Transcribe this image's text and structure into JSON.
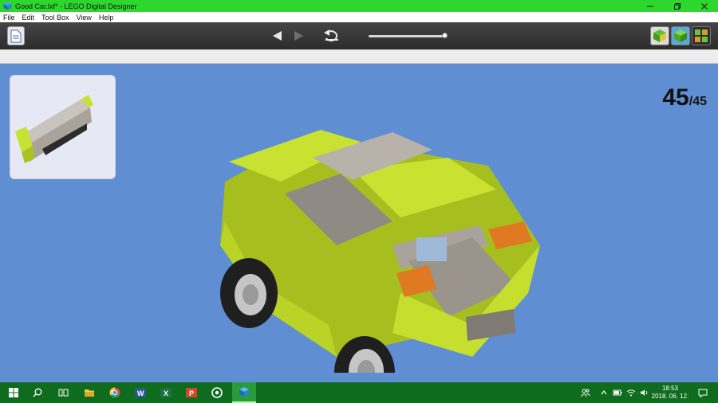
{
  "window": {
    "title": "Good Car.lxf* - LEGO Digital Designer",
    "titlebar_color": "#2ed72e"
  },
  "menu": {
    "items": [
      "File",
      "Edit",
      "Tool Box",
      "View",
      "Help"
    ]
  },
  "toolbar": {
    "slider_position": 1.0
  },
  "viewport": {
    "background_color": "#5f8fd2",
    "step_current": "45",
    "step_total": "/45"
  },
  "taskbar": {
    "color": "#0f6b1e",
    "apps": [
      "start",
      "search",
      "task-view",
      "file-explorer",
      "chrome",
      "word",
      "excel",
      "powerpoint",
      "groove",
      "lego-digital-designer"
    ],
    "time": "18:53",
    "date": "2018. 06. 12."
  }
}
